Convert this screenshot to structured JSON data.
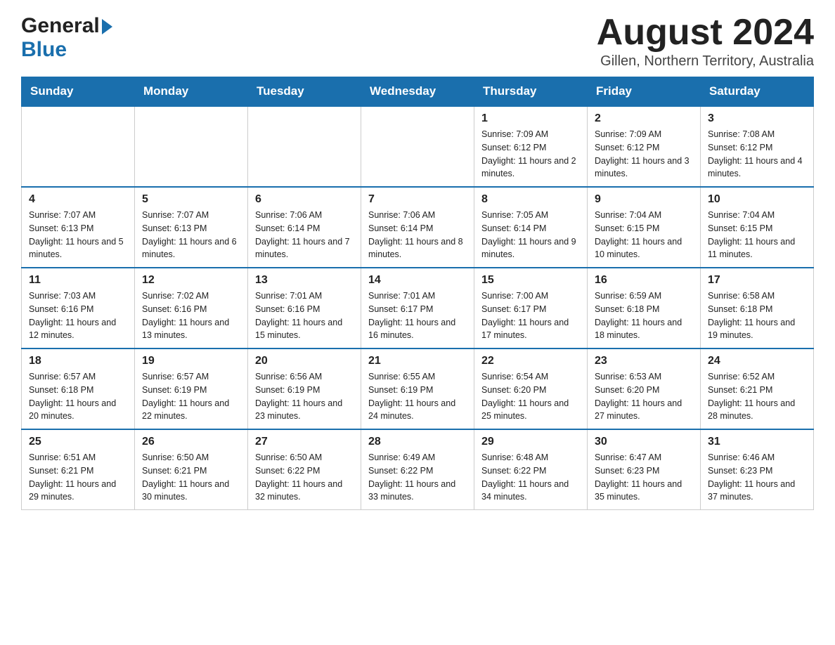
{
  "header": {
    "logo_general": "General",
    "logo_blue": "Blue",
    "month_title": "August 2024",
    "location": "Gillen, Northern Territory, Australia"
  },
  "days_of_week": [
    "Sunday",
    "Monday",
    "Tuesday",
    "Wednesday",
    "Thursday",
    "Friday",
    "Saturday"
  ],
  "weeks": [
    {
      "days": [
        {
          "number": "",
          "info": ""
        },
        {
          "number": "",
          "info": ""
        },
        {
          "number": "",
          "info": ""
        },
        {
          "number": "",
          "info": ""
        },
        {
          "number": "1",
          "info": "Sunrise: 7:09 AM\nSunset: 6:12 PM\nDaylight: 11 hours and 2 minutes."
        },
        {
          "number": "2",
          "info": "Sunrise: 7:09 AM\nSunset: 6:12 PM\nDaylight: 11 hours and 3 minutes."
        },
        {
          "number": "3",
          "info": "Sunrise: 7:08 AM\nSunset: 6:12 PM\nDaylight: 11 hours and 4 minutes."
        }
      ]
    },
    {
      "days": [
        {
          "number": "4",
          "info": "Sunrise: 7:07 AM\nSunset: 6:13 PM\nDaylight: 11 hours and 5 minutes."
        },
        {
          "number": "5",
          "info": "Sunrise: 7:07 AM\nSunset: 6:13 PM\nDaylight: 11 hours and 6 minutes."
        },
        {
          "number": "6",
          "info": "Sunrise: 7:06 AM\nSunset: 6:14 PM\nDaylight: 11 hours and 7 minutes."
        },
        {
          "number": "7",
          "info": "Sunrise: 7:06 AM\nSunset: 6:14 PM\nDaylight: 11 hours and 8 minutes."
        },
        {
          "number": "8",
          "info": "Sunrise: 7:05 AM\nSunset: 6:14 PM\nDaylight: 11 hours and 9 minutes."
        },
        {
          "number": "9",
          "info": "Sunrise: 7:04 AM\nSunset: 6:15 PM\nDaylight: 11 hours and 10 minutes."
        },
        {
          "number": "10",
          "info": "Sunrise: 7:04 AM\nSunset: 6:15 PM\nDaylight: 11 hours and 11 minutes."
        }
      ]
    },
    {
      "days": [
        {
          "number": "11",
          "info": "Sunrise: 7:03 AM\nSunset: 6:16 PM\nDaylight: 11 hours and 12 minutes."
        },
        {
          "number": "12",
          "info": "Sunrise: 7:02 AM\nSunset: 6:16 PM\nDaylight: 11 hours and 13 minutes."
        },
        {
          "number": "13",
          "info": "Sunrise: 7:01 AM\nSunset: 6:16 PM\nDaylight: 11 hours and 15 minutes."
        },
        {
          "number": "14",
          "info": "Sunrise: 7:01 AM\nSunset: 6:17 PM\nDaylight: 11 hours and 16 minutes."
        },
        {
          "number": "15",
          "info": "Sunrise: 7:00 AM\nSunset: 6:17 PM\nDaylight: 11 hours and 17 minutes."
        },
        {
          "number": "16",
          "info": "Sunrise: 6:59 AM\nSunset: 6:18 PM\nDaylight: 11 hours and 18 minutes."
        },
        {
          "number": "17",
          "info": "Sunrise: 6:58 AM\nSunset: 6:18 PM\nDaylight: 11 hours and 19 minutes."
        }
      ]
    },
    {
      "days": [
        {
          "number": "18",
          "info": "Sunrise: 6:57 AM\nSunset: 6:18 PM\nDaylight: 11 hours and 20 minutes."
        },
        {
          "number": "19",
          "info": "Sunrise: 6:57 AM\nSunset: 6:19 PM\nDaylight: 11 hours and 22 minutes."
        },
        {
          "number": "20",
          "info": "Sunrise: 6:56 AM\nSunset: 6:19 PM\nDaylight: 11 hours and 23 minutes."
        },
        {
          "number": "21",
          "info": "Sunrise: 6:55 AM\nSunset: 6:19 PM\nDaylight: 11 hours and 24 minutes."
        },
        {
          "number": "22",
          "info": "Sunrise: 6:54 AM\nSunset: 6:20 PM\nDaylight: 11 hours and 25 minutes."
        },
        {
          "number": "23",
          "info": "Sunrise: 6:53 AM\nSunset: 6:20 PM\nDaylight: 11 hours and 27 minutes."
        },
        {
          "number": "24",
          "info": "Sunrise: 6:52 AM\nSunset: 6:21 PM\nDaylight: 11 hours and 28 minutes."
        }
      ]
    },
    {
      "days": [
        {
          "number": "25",
          "info": "Sunrise: 6:51 AM\nSunset: 6:21 PM\nDaylight: 11 hours and 29 minutes."
        },
        {
          "number": "26",
          "info": "Sunrise: 6:50 AM\nSunset: 6:21 PM\nDaylight: 11 hours and 30 minutes."
        },
        {
          "number": "27",
          "info": "Sunrise: 6:50 AM\nSunset: 6:22 PM\nDaylight: 11 hours and 32 minutes."
        },
        {
          "number": "28",
          "info": "Sunrise: 6:49 AM\nSunset: 6:22 PM\nDaylight: 11 hours and 33 minutes."
        },
        {
          "number": "29",
          "info": "Sunrise: 6:48 AM\nSunset: 6:22 PM\nDaylight: 11 hours and 34 minutes."
        },
        {
          "number": "30",
          "info": "Sunrise: 6:47 AM\nSunset: 6:23 PM\nDaylight: 11 hours and 35 minutes."
        },
        {
          "number": "31",
          "info": "Sunrise: 6:46 AM\nSunset: 6:23 PM\nDaylight: 11 hours and 37 minutes."
        }
      ]
    }
  ]
}
